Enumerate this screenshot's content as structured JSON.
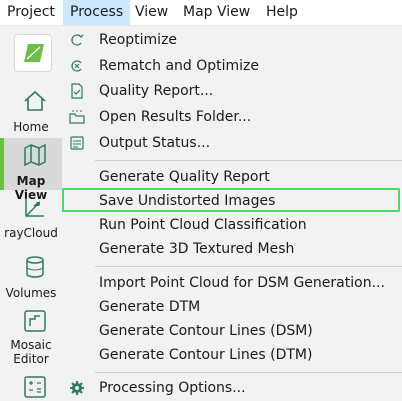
{
  "menubar": {
    "items": [
      {
        "label": "Project"
      },
      {
        "label": "Process"
      },
      {
        "label": "View"
      },
      {
        "label": "Map View"
      },
      {
        "label": "Help"
      }
    ]
  },
  "sidebar": {
    "items": [
      {
        "label": "Home",
        "icon": "home-icon"
      },
      {
        "label": "Map View",
        "icon": "map-icon"
      },
      {
        "label": "rayCloud",
        "icon": "raycloud-icon"
      },
      {
        "label": "Volumes",
        "icon": "volumes-icon"
      },
      {
        "label": "Mosaic Editor",
        "icon": "mosaic-editor-icon"
      },
      {
        "label": "",
        "icon": "calculator-icon"
      }
    ],
    "accent_color": "#6cbe45"
  },
  "menu": {
    "items": [
      {
        "label": "Reoptimize",
        "icon": "reoptimize-icon"
      },
      {
        "label": "Rematch and Optimize",
        "icon": "rematch-icon"
      },
      {
        "label": "Quality Report...",
        "icon": "quality-report-icon"
      },
      {
        "label": "Open Results Folder...",
        "icon": "folder-icon"
      },
      {
        "label": "Output Status...",
        "icon": "output-status-icon"
      },
      {
        "label": "Generate Quality Report"
      },
      {
        "label": "Save Undistorted Images",
        "highlighted": true
      },
      {
        "label": "Run Point Cloud Classification"
      },
      {
        "label": "Generate 3D Textured Mesh"
      },
      {
        "label": "Import Point Cloud for DSM Generation..."
      },
      {
        "label": "Generate DTM"
      },
      {
        "label": "Generate Contour Lines (DSM)"
      },
      {
        "label": "Generate Contour Lines (DTM)"
      },
      {
        "label": "Processing Options...",
        "icon": "gear-icon"
      }
    ],
    "highlight_color": "#4cd964"
  }
}
